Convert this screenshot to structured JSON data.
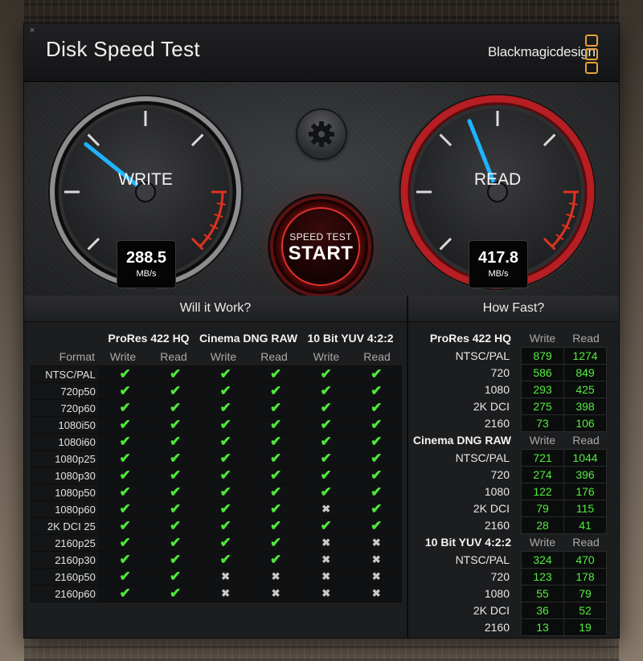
{
  "window": {
    "title": "Disk Speed Test",
    "brand": "Blackmagicdesign",
    "close_glyph": "×"
  },
  "gauges": {
    "write": {
      "label": "WRITE",
      "value": "288.5",
      "unit": "MB/s",
      "needle_fraction": 0.31,
      "accent": "#1fb4ff"
    },
    "read": {
      "label": "READ",
      "value": "417.8",
      "unit": "MB/s",
      "needle_fraction": 0.42,
      "accent": "#1fb4ff",
      "ring_color": "#b51e22"
    }
  },
  "controls": {
    "settings_icon": "gear-icon",
    "start_small": "SPEED TEST",
    "start_big": "START"
  },
  "will_it_work": {
    "title": "Will it Work?",
    "format_label": "Format",
    "groups": [
      "ProRes 422 HQ",
      "Cinema DNG RAW",
      "10 Bit YUV 4:2:2"
    ],
    "sub_labels": [
      "Write",
      "Read"
    ],
    "rows": [
      {
        "format": "NTSC/PAL",
        "cells": [
          true,
          true,
          true,
          true,
          true,
          true
        ]
      },
      {
        "format": "720p50",
        "cells": [
          true,
          true,
          true,
          true,
          true,
          true
        ]
      },
      {
        "format": "720p60",
        "cells": [
          true,
          true,
          true,
          true,
          true,
          true
        ]
      },
      {
        "format": "1080i50",
        "cells": [
          true,
          true,
          true,
          true,
          true,
          true
        ]
      },
      {
        "format": "1080i60",
        "cells": [
          true,
          true,
          true,
          true,
          true,
          true
        ]
      },
      {
        "format": "1080p25",
        "cells": [
          true,
          true,
          true,
          true,
          true,
          true
        ]
      },
      {
        "format": "1080p30",
        "cells": [
          true,
          true,
          true,
          true,
          true,
          true
        ]
      },
      {
        "format": "1080p50",
        "cells": [
          true,
          true,
          true,
          true,
          true,
          true
        ]
      },
      {
        "format": "1080p60",
        "cells": [
          true,
          true,
          true,
          true,
          false,
          true
        ]
      },
      {
        "format": "2K DCI 25",
        "cells": [
          true,
          true,
          true,
          true,
          true,
          true
        ]
      },
      {
        "format": "2160p25",
        "cells": [
          true,
          true,
          true,
          true,
          false,
          false
        ]
      },
      {
        "format": "2160p30",
        "cells": [
          true,
          true,
          true,
          true,
          false,
          false
        ]
      },
      {
        "format": "2160p50",
        "cells": [
          true,
          true,
          false,
          false,
          false,
          false
        ]
      },
      {
        "format": "2160p60",
        "cells": [
          true,
          true,
          false,
          false,
          false,
          false
        ]
      }
    ],
    "check_glyph": "✔",
    "cross_glyph": "✖"
  },
  "how_fast": {
    "title": "How Fast?",
    "sections": [
      {
        "name": "ProRes 422 HQ",
        "write_label": "Write",
        "read_label": "Read",
        "rows": [
          {
            "format": "NTSC/PAL",
            "write": "879",
            "read": "1274"
          },
          {
            "format": "720",
            "write": "586",
            "read": "849"
          },
          {
            "format": "1080",
            "write": "293",
            "read": "425"
          },
          {
            "format": "2K DCI",
            "write": "275",
            "read": "398"
          },
          {
            "format": "2160",
            "write": "73",
            "read": "106"
          }
        ]
      },
      {
        "name": "Cinema DNG RAW",
        "write_label": "Write",
        "read_label": "Read",
        "rows": [
          {
            "format": "NTSC/PAL",
            "write": "721",
            "read": "1044"
          },
          {
            "format": "720",
            "write": "274",
            "read": "396"
          },
          {
            "format": "1080",
            "write": "122",
            "read": "176"
          },
          {
            "format": "2K DCI",
            "write": "79",
            "read": "115"
          },
          {
            "format": "2160",
            "write": "28",
            "read": "41"
          }
        ]
      },
      {
        "name": "10 Bit YUV 4:2:2",
        "write_label": "Write",
        "read_label": "Read",
        "rows": [
          {
            "format": "NTSC/PAL",
            "write": "324",
            "read": "470"
          },
          {
            "format": "720",
            "write": "123",
            "read": "178"
          },
          {
            "format": "1080",
            "write": "55",
            "read": "79"
          },
          {
            "format": "2K DCI",
            "write": "36",
            "read": "52"
          },
          {
            "format": "2160",
            "write": "13",
            "read": "19"
          }
        ]
      }
    ]
  },
  "colors": {
    "check": "#4ee83a",
    "number": "#52ee3e",
    "brand_accent": "#e7a23b",
    "start_ring": "#e03030"
  }
}
